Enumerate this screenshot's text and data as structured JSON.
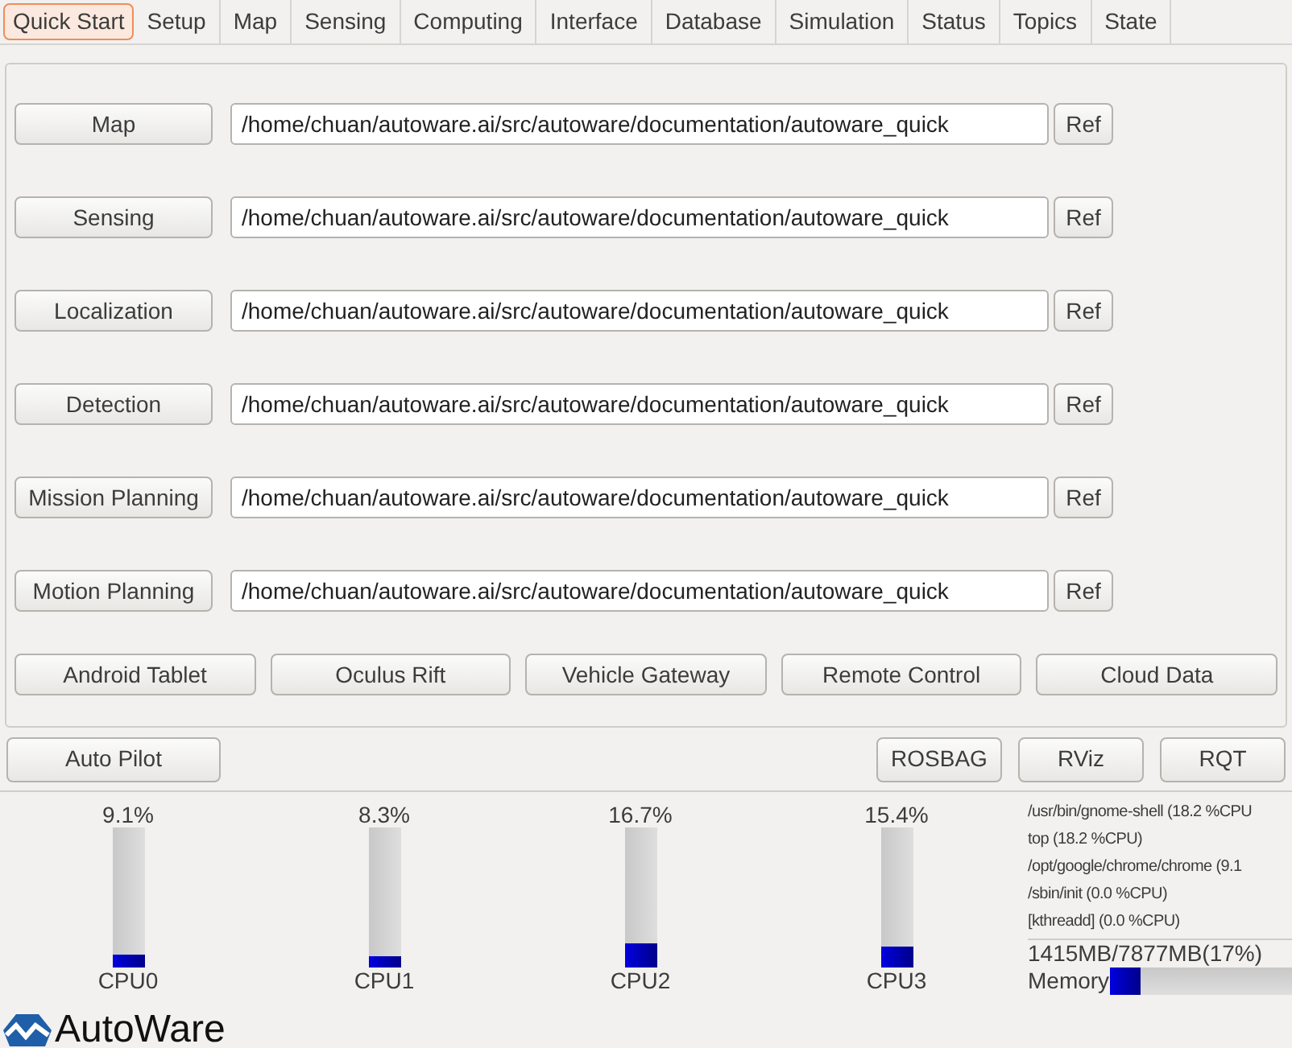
{
  "tabs": [
    {
      "label": "Quick Start",
      "selected": true
    },
    {
      "label": "Setup",
      "selected": false
    },
    {
      "label": "Map",
      "selected": false
    },
    {
      "label": "Sensing",
      "selected": false
    },
    {
      "label": "Computing",
      "selected": false
    },
    {
      "label": "Interface",
      "selected": false
    },
    {
      "label": "Database",
      "selected": false
    },
    {
      "label": "Simulation",
      "selected": false
    },
    {
      "label": "Status",
      "selected": false
    },
    {
      "label": "Topics",
      "selected": false
    },
    {
      "label": "State",
      "selected": false
    }
  ],
  "launch_rows": [
    {
      "button": "Map",
      "path": "/home/chuan/autoware.ai/src/autoware/documentation/autoware_quick",
      "ref": "Ref"
    },
    {
      "button": "Sensing",
      "path": "/home/chuan/autoware.ai/src/autoware/documentation/autoware_quick",
      "ref": "Ref"
    },
    {
      "button": "Localization",
      "path": "/home/chuan/autoware.ai/src/autoware/documentation/autoware_quick",
      "ref": "Ref"
    },
    {
      "button": "Detection",
      "path": "/home/chuan/autoware.ai/src/autoware/documentation/autoware_quick",
      "ref": "Ref"
    },
    {
      "button": "Mission Planning",
      "path": "/home/chuan/autoware.ai/src/autoware/documentation/autoware_quick",
      "ref": "Ref"
    },
    {
      "button": "Motion Planning",
      "path": "/home/chuan/autoware.ai/src/autoware/documentation/autoware_quick",
      "ref": "Ref"
    }
  ],
  "device_buttons": [
    "Android Tablet",
    "Oculus Rift",
    "Vehicle Gateway",
    "Remote Control",
    "Cloud Data"
  ],
  "auto_pilot": "Auto Pilot",
  "tool_buttons": [
    "ROSBAG",
    "RViz",
    "RQT"
  ],
  "cpus": [
    {
      "reading": "9.1%",
      "label": "CPU0",
      "level": 0.091
    },
    {
      "reading": "8.3%",
      "label": "CPU1",
      "level": 0.083
    },
    {
      "reading": "16.7%",
      "label": "CPU2",
      "level": 0.167
    },
    {
      "reading": "15.4%",
      "label": "CPU3",
      "level": 0.154
    }
  ],
  "processes": [
    "/usr/bin/gnome-shell (18.2 %CPU",
    "top (18.2 %CPU)",
    "/opt/google/chrome/chrome (9.1",
    "/sbin/init (0.0 %CPU)",
    "[kthreadd] (0.0 %CPU)"
  ],
  "memory": {
    "reading": "1415MB/7877MB(17%)",
    "label": "Memory",
    "level": 0.17
  },
  "logo": "AutoWare"
}
